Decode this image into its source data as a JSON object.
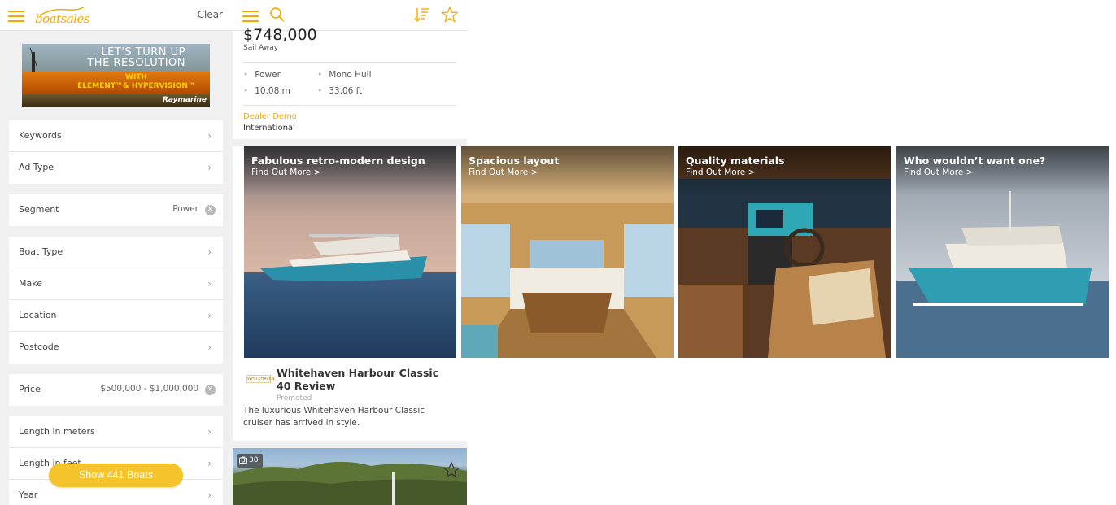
{
  "filter_panel": {
    "clear_label": "Clear",
    "logo_text": "boatsales",
    "ad": {
      "line1": "LET'S TURN UP",
      "line2": "THE RESOLUTION",
      "with": "WITH",
      "products": "ELEMENT™& HYPERVISION™",
      "brand": "Raymarine"
    },
    "groups": [
      [
        {
          "label": "Keywords"
        },
        {
          "label": "Ad Type"
        }
      ],
      [
        {
          "label": "Segment",
          "value": "Power"
        }
      ],
      [
        {
          "label": "Boat Type"
        },
        {
          "label": "Make"
        },
        {
          "label": "Location"
        },
        {
          "label": "Postcode"
        }
      ],
      [
        {
          "label": "Price",
          "value": "$500,000 - $1,000,000"
        }
      ],
      [
        {
          "label": "Length in meters"
        },
        {
          "label": "Length in feet"
        },
        {
          "label": "Year"
        }
      ]
    ],
    "show_button_label": "Show 441 Boats"
  },
  "listing": {
    "price": "$748,000",
    "price_sub": "Sail Away",
    "specs": [
      "Power",
      "Mono Hull",
      "10.08 m",
      "33.06 ft"
    ],
    "dealer_status": "Dealer Demo",
    "dealer_location": "International"
  },
  "promo": {
    "logo_text": "WHITEHAVEN",
    "title": "Whitehaven Harbour Classic 40 Review",
    "tag": "Promoted",
    "description": "The luxurious Whitehaven Harbour Classic cruiser has arrived in style."
  },
  "carousel": [
    {
      "title": "Fabulous retro-modern design",
      "cta": "Find Out More >"
    },
    {
      "title": "Spacious layout",
      "cta": "Find Out More >"
    },
    {
      "title": "Quality materials",
      "cta": "Find Out More >"
    },
    {
      "title": "Who wouldn’t want one?",
      "cta": "Find Out More >"
    }
  ],
  "next_listing": {
    "photo_count": "38"
  },
  "colors": {
    "accent": "#f2a900",
    "button": "#f5c42c",
    "panel_bg": "#f0f0f0"
  },
  "icons": [
    "hamburger-icon",
    "search-icon",
    "sort-icon",
    "star-icon",
    "chevron-right-icon",
    "clear-icon",
    "camera-icon"
  ]
}
